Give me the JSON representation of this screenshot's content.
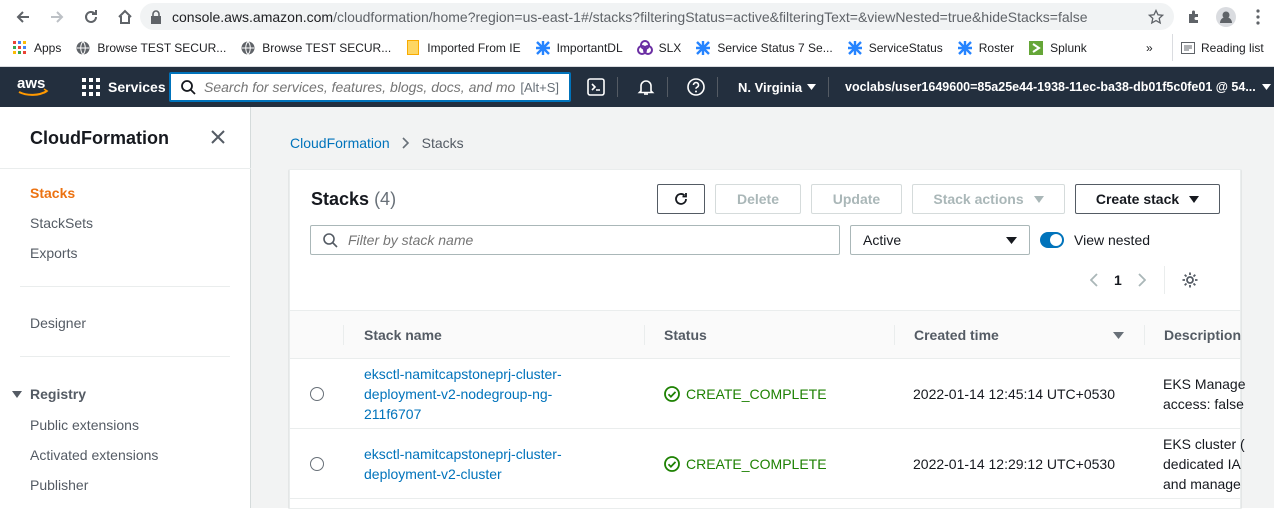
{
  "browser": {
    "url_host": "console.aws.amazon.com",
    "url_path": "/cloudformation/home?region=us-east-1#/stacks?filteringStatus=active&filteringText=&viewNested=true&hideStacks=false",
    "bookmarks": [
      {
        "label": "Apps",
        "icon": "apps-grid-icon"
      },
      {
        "label": "Browse TEST SECUR...",
        "icon": "globe-icon"
      },
      {
        "label": "Browse TEST SECUR...",
        "icon": "globe-icon"
      },
      {
        "label": "Imported From IE",
        "icon": "folder-icon"
      },
      {
        "label": "ImportantDL",
        "icon": "jira-icon"
      },
      {
        "label": "SLX",
        "icon": "slx-icon"
      },
      {
        "label": "Service Status 7 Se...",
        "icon": "jira-icon"
      },
      {
        "label": "ServiceStatus",
        "icon": "jira-icon"
      },
      {
        "label": "Roster",
        "icon": "jira-icon"
      },
      {
        "label": "Splunk",
        "icon": "splunk-icon"
      }
    ],
    "more_label": "»",
    "reading_list": "Reading list"
  },
  "awsnav": {
    "logo": "aws",
    "services": "Services",
    "search_placeholder": "Search for services, features, blogs, docs, and mo",
    "search_shortcut": "[Alt+S]",
    "region": "N. Virginia",
    "account": "voclabs/user1649600=85a25e44-1938-11ec-ba38-db01f5c0fe01 @ 54..."
  },
  "sidebar": {
    "title": "CloudFormation",
    "items": [
      {
        "label": "Stacks"
      },
      {
        "label": "StackSets"
      },
      {
        "label": "Exports"
      }
    ],
    "designer": "Designer",
    "registry_section": "Registry",
    "registry_items": [
      {
        "label": "Public extensions"
      },
      {
        "label": "Activated extensions"
      },
      {
        "label": "Publisher"
      }
    ]
  },
  "main": {
    "breadcrumb": {
      "root": "CloudFormation",
      "current": "Stacks"
    },
    "panel": {
      "title": "Stacks",
      "count": "(4)",
      "buttons": {
        "delete": "Delete",
        "update": "Update",
        "stack_actions": "Stack actions",
        "create_stack": "Create stack"
      },
      "filter_placeholder": "Filter by stack name",
      "status_filter": "Active",
      "view_nested": "View nested",
      "page": "1"
    },
    "table": {
      "columns": {
        "name": "Stack name",
        "status": "Status",
        "created": "Created time",
        "description": "Description"
      },
      "rows": [
        {
          "name": "eksctl-namitcapstoneprj-cluster-deployment-v2-nodegroup-ng-211f6707",
          "status": "CREATE_COMPLETE",
          "created": "2022-01-14 12:45:14 UTC+0530",
          "description": "EKS Manage\naccess: false"
        },
        {
          "name": "eksctl-namitcapstoneprj-cluster-deployment-v2-cluster",
          "status": "CREATE_COMPLETE",
          "created": "2022-01-14 12:29:12 UTC+0530",
          "description": "EKS cluster (\ndedicated IA\nand manage"
        }
      ]
    }
  },
  "colors": {
    "aws_nav": "#232f3e",
    "link": "#0073bb",
    "active_nav": "#ec7211",
    "success": "#1d8102"
  }
}
